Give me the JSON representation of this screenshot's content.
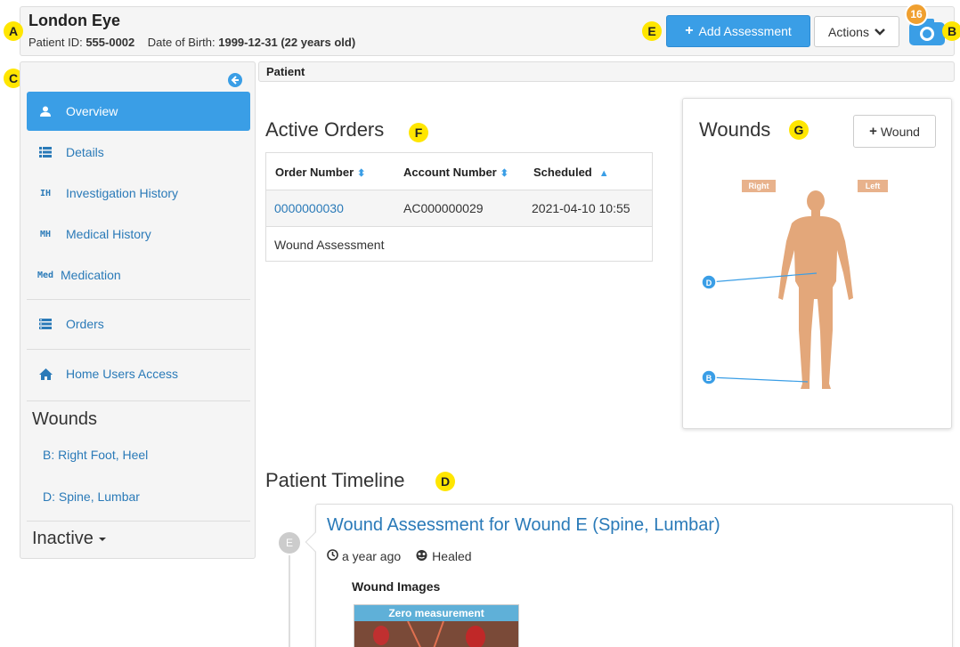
{
  "header": {
    "patient_name": "London Eye",
    "patient_id_label": "Patient ID:",
    "patient_id": "555-0002",
    "dob_label": "Date of Birth:",
    "dob": "1999-12-31 (22 years old)",
    "add_assessment_label": "Add Assessment",
    "actions_label": "Actions",
    "camera_count": "16"
  },
  "callouts": {
    "a": "A",
    "b": "B",
    "c": "C",
    "d": "D",
    "e": "E",
    "f": "F",
    "g": "G"
  },
  "sidebar": {
    "items": [
      {
        "label": "Overview",
        "icon": "user-icon",
        "glyph": ""
      },
      {
        "label": "Details",
        "icon": "list-icon",
        "glyph": ""
      },
      {
        "label": "Investigation History",
        "icon": "ih-icon",
        "glyph": "IH"
      },
      {
        "label": "Medical History",
        "icon": "mh-icon",
        "glyph": "MH"
      },
      {
        "label": "Medication",
        "icon": "med-icon",
        "glyph": "Med"
      },
      {
        "label": "Orders",
        "icon": "orders-icon",
        "glyph": ""
      },
      {
        "label": "Home Users Access",
        "icon": "home-icon",
        "glyph": ""
      }
    ],
    "wounds_heading": "Wounds",
    "wound_links": [
      "B: Right Foot, Heel",
      "D: Spine, Lumbar"
    ],
    "inactive_label": "Inactive"
  },
  "breadcrumb": "Patient",
  "orders": {
    "title": "Active Orders",
    "columns": [
      "Order Number",
      "Account Number",
      "Scheduled"
    ],
    "rows": [
      {
        "order_number": "0000000030",
        "account_number": "AC000000029",
        "scheduled": "2021-04-10 10:55"
      }
    ],
    "detail": "Wound Assessment"
  },
  "wounds": {
    "title": "Wounds",
    "add_label": "Wound",
    "right_label": "Right",
    "left_label": "Left",
    "markers": [
      "D",
      "B"
    ]
  },
  "timeline": {
    "title": "Patient Timeline",
    "dot_label": "E",
    "card_title": "Wound Assessment for Wound E (Spine, Lumbar)",
    "time_ago": "a year ago",
    "status": "Healed",
    "images_label": "Wound Images",
    "thumb_label": "Zero measurement"
  },
  "colors": {
    "primary": "#3a9ee6",
    "link": "#2a7ab8",
    "skin": "#e3a77a",
    "callout": "#ffe600",
    "badge": "#f0a030"
  }
}
